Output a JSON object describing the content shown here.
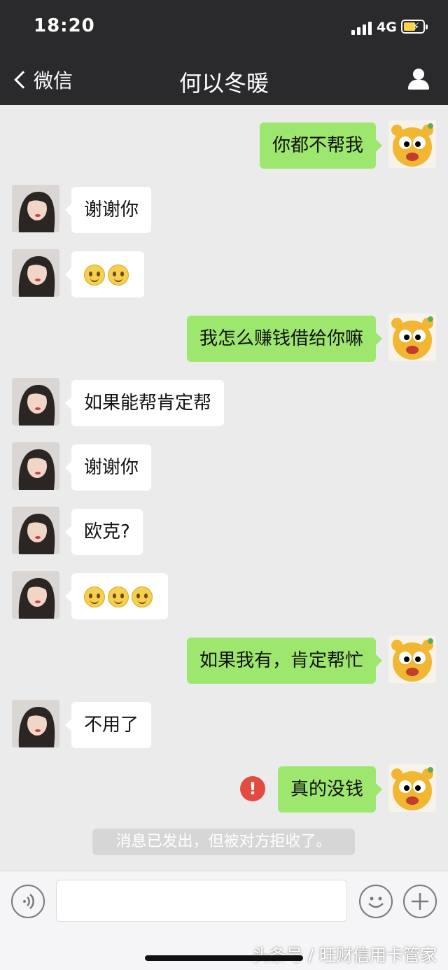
{
  "status": {
    "time": "18:20",
    "network": "4G"
  },
  "nav": {
    "back_label": "微信",
    "title": "何以冬暖"
  },
  "messages": [
    {
      "side": "right",
      "text": "你都不帮我"
    },
    {
      "side": "left",
      "text": "谢谢你"
    },
    {
      "side": "left",
      "text": "",
      "emoji": "smile-emoji x2"
    },
    {
      "side": "right",
      "text": "我怎么赚钱借给你嘛"
    },
    {
      "side": "left",
      "text": "如果能帮肯定帮"
    },
    {
      "side": "left",
      "text": "谢谢你"
    },
    {
      "side": "left",
      "text": "欧克?"
    },
    {
      "side": "left",
      "text": "",
      "emoji": "smile-emoji x3"
    },
    {
      "side": "right",
      "text": "如果我有，肯定帮忙"
    },
    {
      "side": "left",
      "text": "不用了"
    },
    {
      "side": "right",
      "text": "真的没钱",
      "error": "!"
    }
  ],
  "notice": "消息已发出，但被对方拒收了。",
  "input": {
    "value": "",
    "placeholder": ""
  },
  "watermark": "头条号 / 旺财信用卡管家",
  "colors": {
    "bar": "#2a2a2c",
    "bubble_me": "#9ee76e",
    "bubble_them": "#ffffff",
    "error": "#e14b40"
  },
  "icons": [
    "back-arrow-icon",
    "profile-icon",
    "voice-icon",
    "emoji-icon",
    "plus-icon",
    "error-icon",
    "smile-emoji"
  ]
}
